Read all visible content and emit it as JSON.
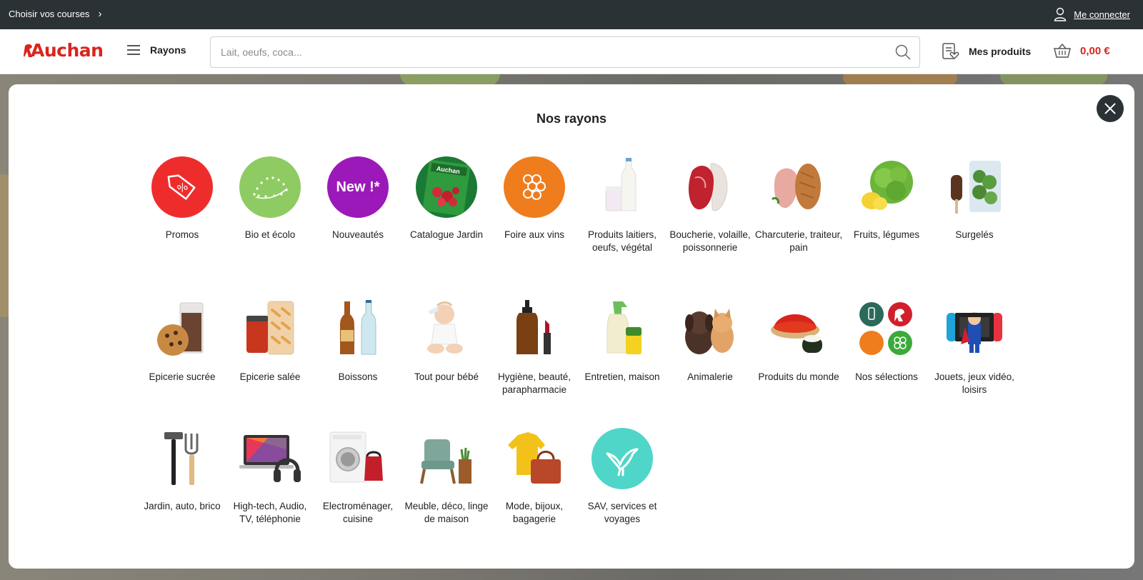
{
  "topbar": {
    "choose_label": "Choisir vos courses",
    "login_label": "Me connecter"
  },
  "header": {
    "logo_text": "Auchan",
    "rayons_label": "Rayons",
    "search_placeholder": "Lait, oeufs, coca...",
    "my_products_label": "Mes produits",
    "cart_total": "0,00 €"
  },
  "colors": {
    "brand_red": "#d9251d",
    "dark": "#2a3236",
    "bio_green": "#8fcb63",
    "new_purple": "#9b19b9",
    "vin_orange": "#ef7d1e",
    "sav_teal": "#4fd6c8"
  },
  "modal": {
    "title": "Nos rayons",
    "categories": [
      {
        "label": "Promos",
        "icon": "promo-tag-icon"
      },
      {
        "label": "Bio et écolo",
        "icon": "eu-organic-leaf-icon"
      },
      {
        "label": "Nouveautés",
        "icon": "new-badge-icon",
        "badge_text": "New !*"
      },
      {
        "label": "Catalogue Jardin",
        "icon": "garden-catalogue-icon"
      },
      {
        "label": "Foire aux vins",
        "icon": "grape-icon"
      },
      {
        "label": "Produits laitiers, oeufs, végétal",
        "icon": "milk-bottle-icon"
      },
      {
        "label": "Boucherie, volaille, poissonnerie",
        "icon": "meat-fish-icon"
      },
      {
        "label": "Charcuterie, traiteur, pain",
        "icon": "bread-ham-icon"
      },
      {
        "label": "Fruits, légumes",
        "icon": "lettuce-lemon-icon"
      },
      {
        "label": "Surgelés",
        "icon": "frozen-food-icon"
      },
      {
        "label": "Epicerie sucrée",
        "icon": "cookie-chocolate-icon"
      },
      {
        "label": "Epicerie salée",
        "icon": "pasta-sauce-icon"
      },
      {
        "label": "Boissons",
        "icon": "bottles-icon"
      },
      {
        "label": "Tout pour bébé",
        "icon": "baby-icon"
      },
      {
        "label": "Hygiène, beauté, parapharmacie",
        "icon": "soap-lipstick-icon"
      },
      {
        "label": "Entretien, maison",
        "icon": "spray-sponge-icon"
      },
      {
        "label": "Animalerie",
        "icon": "puppy-kitten-icon"
      },
      {
        "label": "Produits du monde",
        "icon": "spice-sushi-icon"
      },
      {
        "label": "Nos sélections",
        "icon": "selection-badges-icon"
      },
      {
        "label": "Jouets, jeux vidéo, loisirs",
        "icon": "toy-console-icon"
      },
      {
        "label": "Jardin, auto, brico",
        "icon": "hammer-fork-icon"
      },
      {
        "label": "High-tech, Audio, TV, téléphonie",
        "icon": "laptop-headphones-icon"
      },
      {
        "label": "Electroménager, cuisine",
        "icon": "washer-kettle-icon"
      },
      {
        "label": "Meuble, déco, linge de maison",
        "icon": "armchair-icon"
      },
      {
        "label": "Mode, bijoux, bagagerie",
        "icon": "sweater-bag-icon"
      },
      {
        "label": "SAV, services et voyages",
        "icon": "bird-icon"
      }
    ]
  }
}
